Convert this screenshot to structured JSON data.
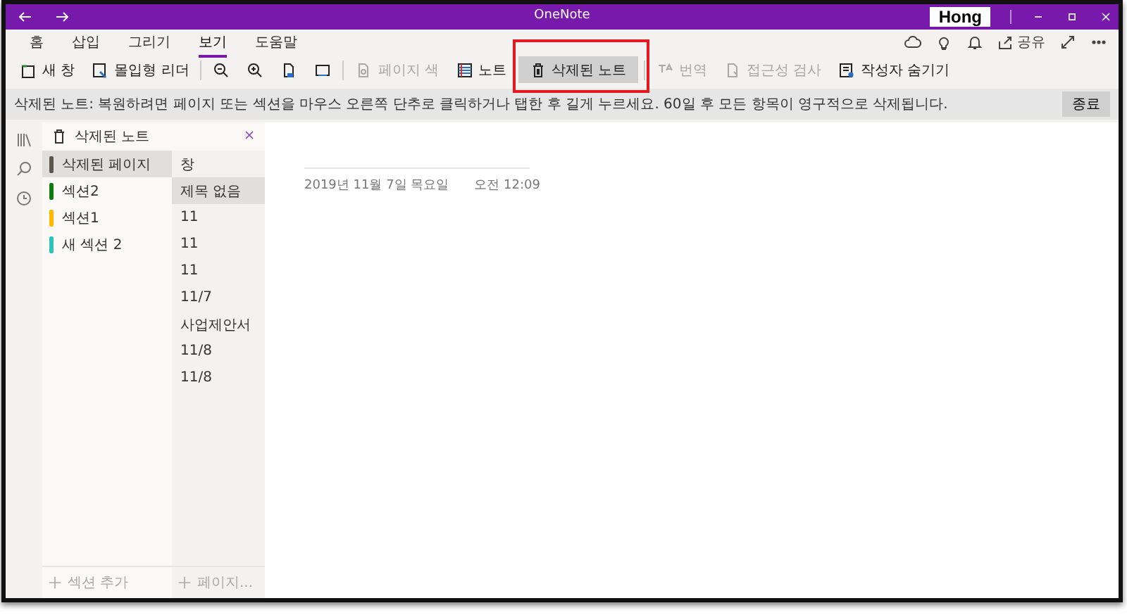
{
  "window": {
    "title": "OneNote",
    "user": "Hong"
  },
  "ribbon_tabs": [
    {
      "label": "홈",
      "selected": false
    },
    {
      "label": "삽입",
      "selected": false
    },
    {
      "label": "그리기",
      "selected": false
    },
    {
      "label": "보기",
      "selected": true
    },
    {
      "label": "도움말",
      "selected": false
    }
  ],
  "top_actions": [
    {
      "kind": "sync"
    },
    {
      "kind": "lightbulb"
    },
    {
      "kind": "bell"
    },
    {
      "kind": "share",
      "label": "공유"
    },
    {
      "kind": "expand"
    },
    {
      "kind": "more"
    }
  ],
  "toolbar": [
    {
      "kind": "new-window",
      "label": "새 창",
      "disabled": false,
      "selected": false,
      "highlighted": false
    },
    {
      "kind": "reader",
      "label": "몰입형 리더",
      "disabled": false,
      "selected": false,
      "highlighted": false
    },
    {
      "kind": "zoom-out",
      "disabled": false,
      "selected": false,
      "highlighted": false
    },
    {
      "kind": "zoom-in",
      "disabled": false,
      "selected": false,
      "highlighted": false
    },
    {
      "kind": "page-width",
      "disabled": false,
      "selected": false,
      "highlighted": false
    },
    {
      "kind": "fit",
      "disabled": false,
      "selected": false,
      "highlighted": false
    },
    {
      "kind": "page-color",
      "label": "페이지 색",
      "disabled": true,
      "selected": false,
      "highlighted": false
    },
    {
      "kind": "lines",
      "label": "노트",
      "disabled": false,
      "selected": false,
      "highlighted": false
    },
    {
      "kind": "trash",
      "label": "삭제된 노트",
      "disabled": false,
      "selected": true,
      "highlighted": true
    },
    {
      "kind": "translate",
      "label": "번역",
      "disabled": true,
      "selected": false,
      "highlighted": false
    },
    {
      "kind": "accessibility",
      "label": "접근성 검사",
      "disabled": true,
      "selected": false,
      "highlighted": false
    },
    {
      "kind": "authors",
      "label": "작성자 숨기기",
      "disabled": false,
      "selected": false,
      "highlighted": false
    }
  ],
  "info_bar": {
    "message": "삭제된 노트: 복원하려면 페이지 또는 섹션을 마우스 오른쪽 단추로 클릭하거나 탭한 후 길게 누르세요. 60일 후 모든 항목이 영구적으로 삭제됩니다.",
    "button": "종료"
  },
  "notebook": {
    "title": "삭제된 노트"
  },
  "sections": [
    {
      "name": "삭제된 페이지",
      "color": "#5f5550",
      "selected": true
    },
    {
      "name": "섹션2",
      "color": "#107c10",
      "selected": false
    },
    {
      "name": "섹션1",
      "color": "#ffb900",
      "selected": false
    },
    {
      "name": "새 섹션 2",
      "color": "#2ec4b6",
      "selected": false
    }
  ],
  "pages": [
    {
      "title": "창",
      "selected": false
    },
    {
      "title": "제목 없음",
      "selected": true
    },
    {
      "title": "11",
      "selected": false
    },
    {
      "title": "11",
      "selected": false
    },
    {
      "title": "11",
      "selected": false
    },
    {
      "title": "11/7",
      "selected": false
    },
    {
      "title": "사업제안서",
      "selected": false
    },
    {
      "title": "11/8",
      "selected": false
    },
    {
      "title": "11/8",
      "selected": false
    }
  ],
  "add_section": "섹션 추가",
  "add_page": "페이지...",
  "page": {
    "date": "2019년 11월 7일 목요일",
    "time": "오전 12:09"
  }
}
